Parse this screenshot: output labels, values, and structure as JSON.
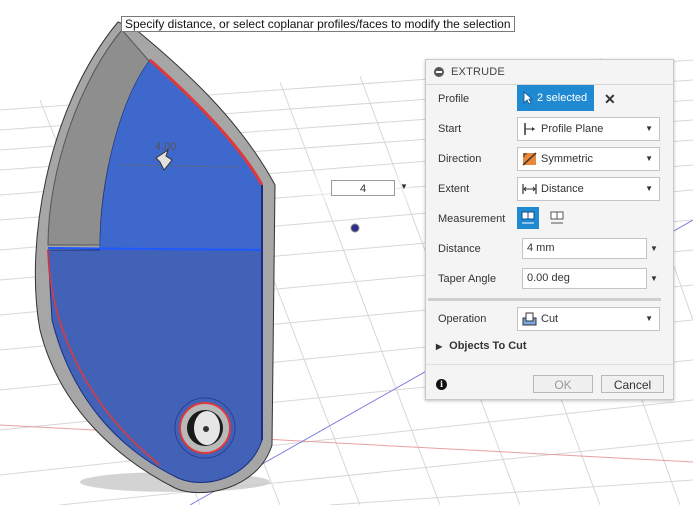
{
  "tooltip": "Specify distance, or select coplanar profiles/faces to modify the selection",
  "viewport": {
    "distance_input": "4",
    "dim_label": "4.00"
  },
  "dialog": {
    "title": "EXTRUDE",
    "profile": {
      "label": "Profile",
      "value": "2 selected"
    },
    "start": {
      "label": "Start",
      "value": "Profile Plane"
    },
    "direction": {
      "label": "Direction",
      "value": "Symmetric"
    },
    "extent": {
      "label": "Extent",
      "value": "Distance"
    },
    "measurement": {
      "label": "Measurement"
    },
    "distance": {
      "label": "Distance",
      "value": "4 mm"
    },
    "taper": {
      "label": "Taper Angle",
      "value": "0.00 deg"
    },
    "operation": {
      "label": "Operation",
      "value": "Cut"
    },
    "objects_to_cut": "Objects To Cut",
    "ok": "OK",
    "cancel": "Cancel"
  },
  "colors": {
    "selection_blue": "#1f8ad2",
    "cut_red": "#e0393b",
    "body_gray": "#9c9c9c",
    "grid": "#d0d0d0",
    "profile_fill": "#2f56b8"
  },
  "icons": [
    "collapse-icon",
    "pointer-icon",
    "close-icon",
    "start-plane-icon",
    "symmetric-icon",
    "distance-icon",
    "measurement-symmetric-icon",
    "measurement-whole-icon",
    "cut-icon",
    "info-icon",
    "chevron-down-icon",
    "expand-triangle-icon"
  ]
}
